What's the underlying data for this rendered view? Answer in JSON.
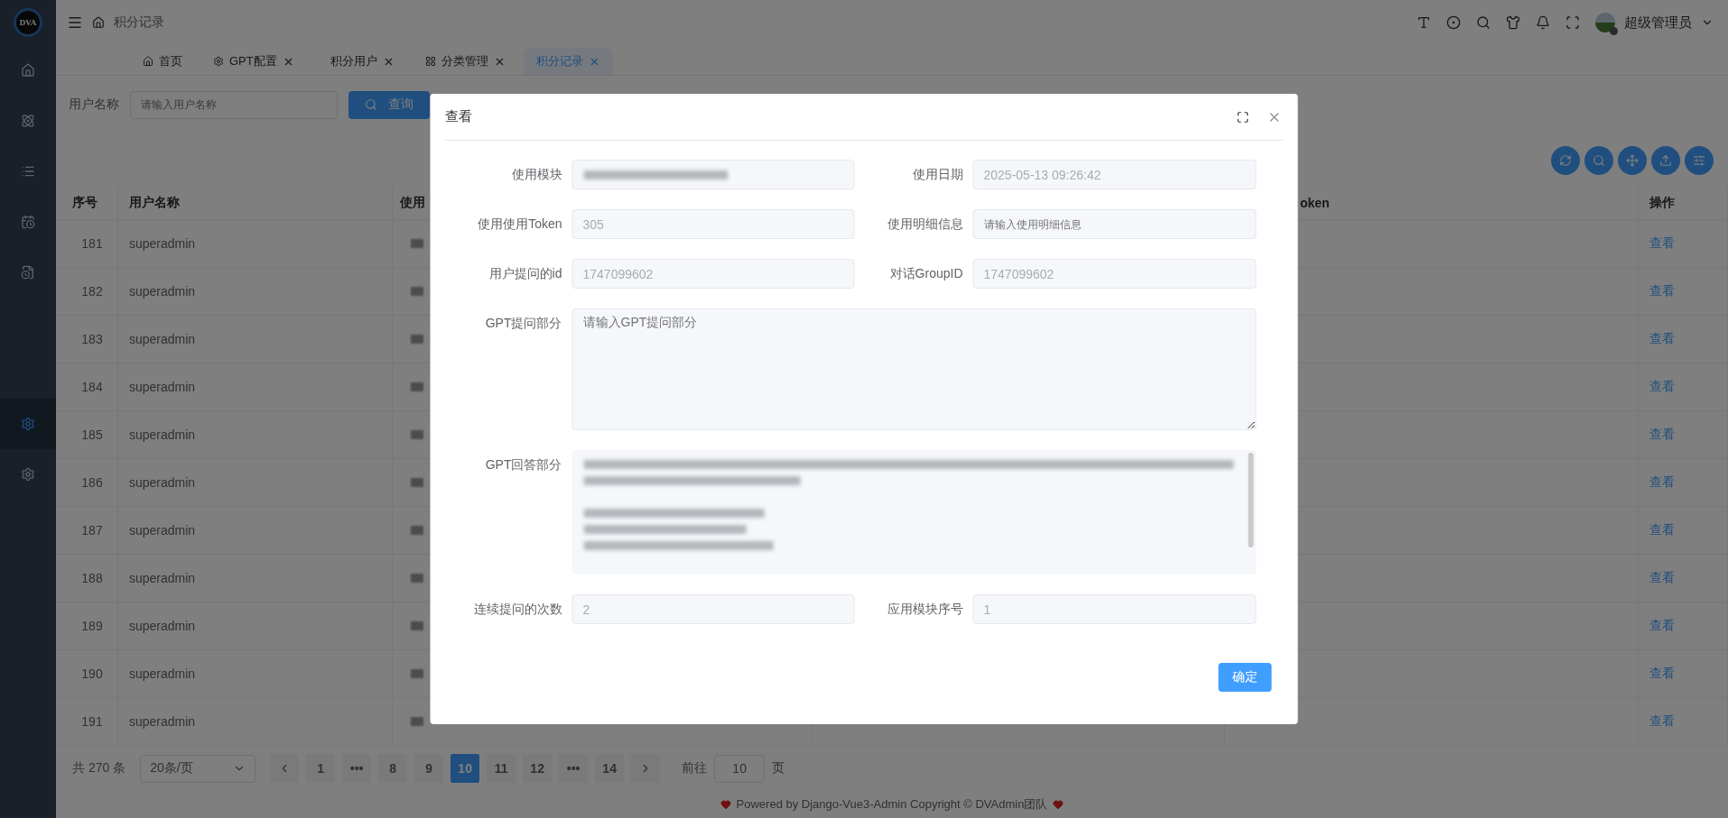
{
  "sidebar": {
    "logo_text": "DVA",
    "items": [
      {
        "selected": false
      },
      {
        "selected": false
      },
      {
        "selected": false
      },
      {
        "selected": false
      },
      {
        "selected": false
      },
      {
        "selected": true
      },
      {
        "selected": false
      }
    ]
  },
  "header": {
    "breadcrumb": "积分记录",
    "user": "超级管理员"
  },
  "tabs": [
    {
      "label": "首页",
      "closable": false,
      "selected": false
    },
    {
      "label": "GPT配置",
      "closable": true,
      "selected": false
    },
    {
      "label": "积分用户",
      "closable": true,
      "selected": false
    },
    {
      "label": "分类管理",
      "closable": true,
      "selected": false
    },
    {
      "label": "积分记录",
      "closable": true,
      "selected": true
    }
  ],
  "search": {
    "label": "用户名称",
    "placeholder": "请输入用户名称",
    "button": "查询"
  },
  "table": {
    "columns": [
      "序号",
      "用户名称",
      "使用",
      "oken",
      "操作"
    ],
    "rows": [
      {
        "index": "181",
        "user": "superadmin",
        "action": "查看"
      },
      {
        "index": "182",
        "user": "superadmin",
        "action": "查看"
      },
      {
        "index": "183",
        "user": "superadmin",
        "action": "查看"
      },
      {
        "index": "184",
        "user": "superadmin",
        "action": "查看"
      },
      {
        "index": "185",
        "user": "superadmin",
        "action": "查看"
      },
      {
        "index": "186",
        "user": "superadmin",
        "action": "查看"
      },
      {
        "index": "187",
        "user": "superadmin",
        "action": "查看"
      },
      {
        "index": "188",
        "user": "superadmin",
        "action": "查看"
      },
      {
        "index": "189",
        "user": "superadmin",
        "action": "查看"
      },
      {
        "index": "190",
        "user": "superadmin",
        "action": "查看"
      },
      {
        "index": "191",
        "user": "superadmin",
        "action": "查看"
      }
    ]
  },
  "pagination": {
    "total": "共 270 条",
    "page_size": "20条/页",
    "pages": [
      {
        "label": "1",
        "selected": false
      },
      {
        "label": "•••",
        "selected": false
      },
      {
        "label": "8",
        "selected": false
      },
      {
        "label": "9",
        "selected": false
      },
      {
        "label": "10",
        "selected": true
      },
      {
        "label": "11",
        "selected": false
      },
      {
        "label": "12",
        "selected": false
      },
      {
        "label": "•••",
        "selected": false
      },
      {
        "label": "14",
        "selected": false
      }
    ],
    "goto_label": "前往",
    "goto_value": "10",
    "goto_suffix": "页"
  },
  "footer": "Powered by Django-Vue3-Admin Copyright © DVAdmin团队",
  "dialog": {
    "title": "查看",
    "fields": [
      {
        "label": "使用模块",
        "kind": "blurred"
      },
      {
        "label": "使用日期",
        "kind": "input",
        "value": "2025-05-13 09:26:42"
      },
      {
        "label": "使用使用Token",
        "kind": "input",
        "value": "305"
      },
      {
        "label": "使用明细信息",
        "kind": "input",
        "placeholder": "请输入使用明细信息"
      },
      {
        "label": "用户提问的id",
        "kind": "input",
        "value": "1747099602"
      },
      {
        "label": "对话GroupID",
        "kind": "input",
        "value": "1747099602"
      },
      {
        "label": "GPT提问部分",
        "kind": "textarea",
        "placeholder": "请输入GPT提问部分"
      },
      {
        "label": "GPT回答部分",
        "kind": "blurred_textarea"
      },
      {
        "label": "连续提问的次数",
        "kind": "input",
        "value": "2"
      },
      {
        "label": "应用模块序号",
        "kind": "input",
        "value": "1"
      }
    ],
    "confirm": "确定"
  }
}
